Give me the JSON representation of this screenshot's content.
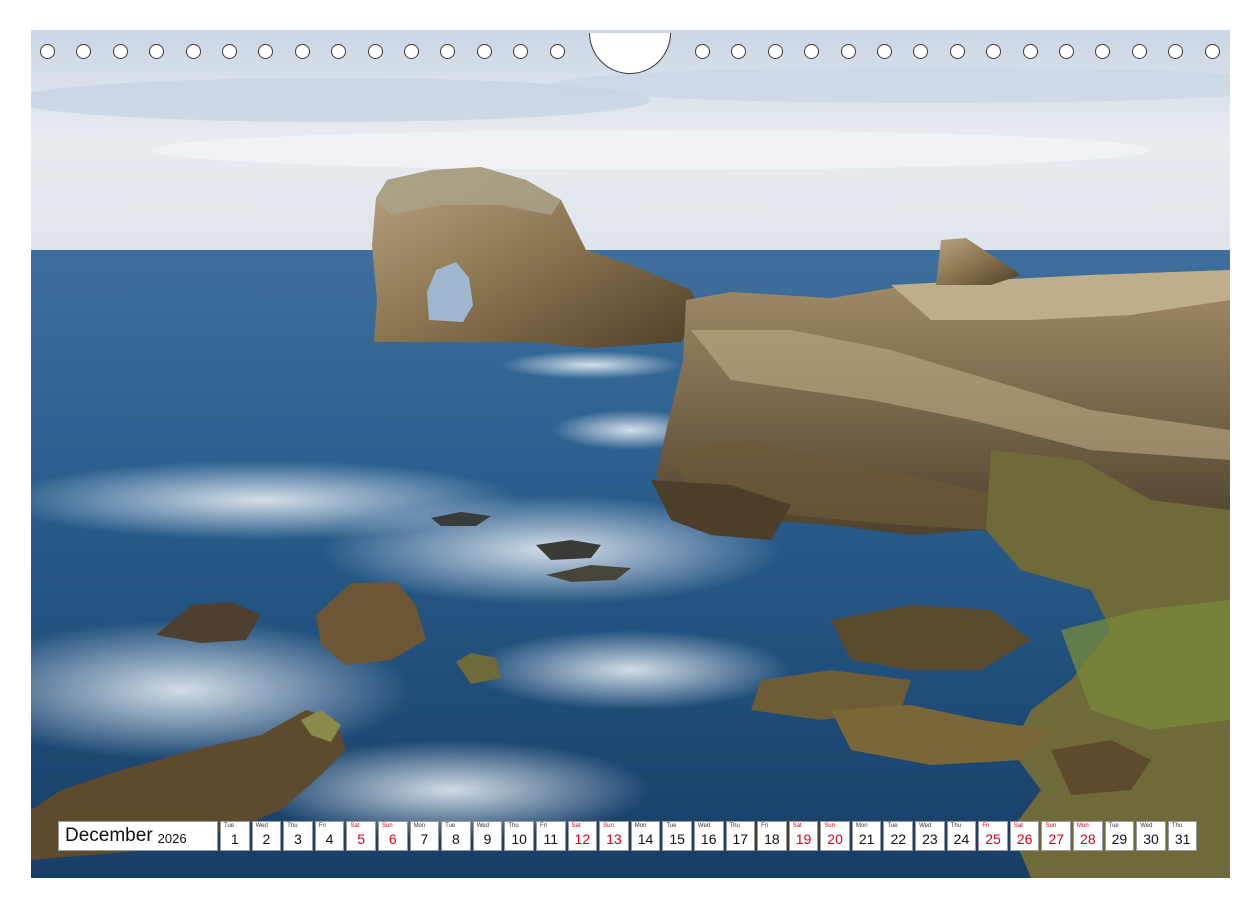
{
  "image": {
    "subject": "sea arch and rocky coastline",
    "colors": {
      "sky": "#dfe5ec",
      "sea": "#2a5f8f",
      "rock": "#8a7450",
      "foam": "#e8eef4",
      "holiday": "#d0021b"
    }
  },
  "binding": {
    "hole_count_left": 15,
    "hole_count_right": 15
  },
  "calendar": {
    "month": "December",
    "year": "2026",
    "days": [
      {
        "wd": "Tue",
        "d": "1",
        "red": false
      },
      {
        "wd": "Wed",
        "d": "2",
        "red": false
      },
      {
        "wd": "Thu",
        "d": "3",
        "red": false
      },
      {
        "wd": "Fri",
        "d": "4",
        "red": false
      },
      {
        "wd": "Sat",
        "d": "5",
        "red": true
      },
      {
        "wd": "Sun",
        "d": "6",
        "red": true
      },
      {
        "wd": "Mon",
        "d": "7",
        "red": false
      },
      {
        "wd": "Tue",
        "d": "8",
        "red": false
      },
      {
        "wd": "Wed",
        "d": "9",
        "red": false
      },
      {
        "wd": "Thu",
        "d": "10",
        "red": false
      },
      {
        "wd": "Fri",
        "d": "11",
        "red": false
      },
      {
        "wd": "Sat",
        "d": "12",
        "red": true
      },
      {
        "wd": "Sun",
        "d": "13",
        "red": true
      },
      {
        "wd": "Mon",
        "d": "14",
        "red": false
      },
      {
        "wd": "Tue",
        "d": "15",
        "red": false
      },
      {
        "wd": "Wed",
        "d": "16",
        "red": false
      },
      {
        "wd": "Thu",
        "d": "17",
        "red": false
      },
      {
        "wd": "Fri",
        "d": "18",
        "red": false
      },
      {
        "wd": "Sat",
        "d": "19",
        "red": true
      },
      {
        "wd": "Sun",
        "d": "20",
        "red": true
      },
      {
        "wd": "Mon",
        "d": "21",
        "red": false
      },
      {
        "wd": "Tue",
        "d": "22",
        "red": false
      },
      {
        "wd": "Wed",
        "d": "23",
        "red": false
      },
      {
        "wd": "Thu",
        "d": "24",
        "red": false
      },
      {
        "wd": "Fri",
        "d": "25",
        "red": true
      },
      {
        "wd": "Sat",
        "d": "26",
        "red": true
      },
      {
        "wd": "Sun",
        "d": "27",
        "red": true
      },
      {
        "wd": "Mon",
        "d": "28",
        "red": true
      },
      {
        "wd": "Tue",
        "d": "29",
        "red": false
      },
      {
        "wd": "Wed",
        "d": "30",
        "red": false
      },
      {
        "wd": "Thu",
        "d": "31",
        "red": false
      }
    ]
  }
}
